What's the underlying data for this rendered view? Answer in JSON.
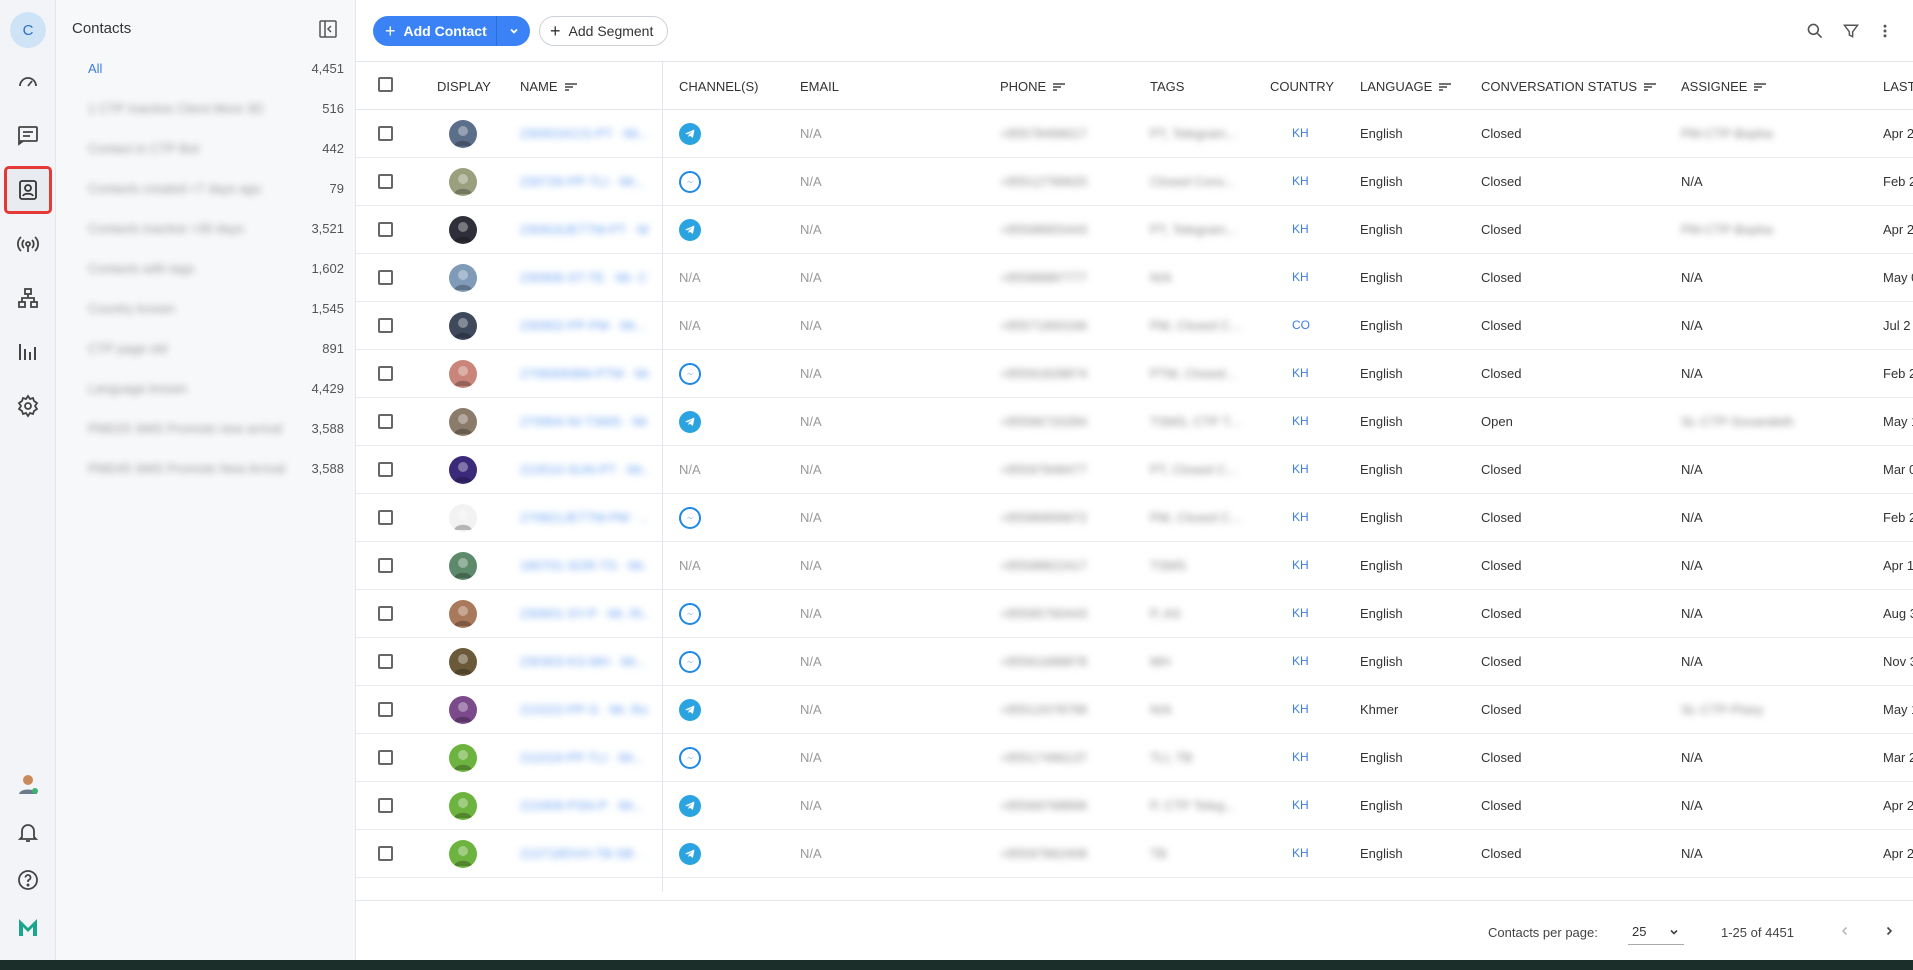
{
  "rail": {
    "avatar_letter": "C",
    "icons": [
      "dashboard-icon",
      "chat-icon",
      "contacts-icon",
      "broadcast-icon",
      "workflow-icon",
      "reports-icon",
      "settings-icon"
    ],
    "bottom_icons": [
      "user-avatar",
      "bell-icon",
      "help-icon",
      "brand-logo"
    ]
  },
  "sidebar": {
    "title": "Contacts",
    "segments": [
      {
        "name": "All",
        "count": "4,451"
      },
      {
        "name": "1 CTP Inactive Client More 3D",
        "count": "516"
      },
      {
        "name": "Contact in CTP Bot",
        "count": "442"
      },
      {
        "name": "Contacts created <7 days ago",
        "count": "79"
      },
      {
        "name": "Contacts inactive >30 days",
        "count": "3,521"
      },
      {
        "name": "Contacts with tags",
        "count": "1,602"
      },
      {
        "name": "Country known",
        "count": "1,545"
      },
      {
        "name": "CTP page old",
        "count": "891"
      },
      {
        "name": "Language known",
        "count": "4,429"
      },
      {
        "name": "PMD25 SMS Promote new arrival",
        "count": "3,588"
      },
      {
        "name": "PMD45 SMS Promote New Arrival",
        "count": "3,588"
      }
    ]
  },
  "toolbar": {
    "add_contact": "Add Contact",
    "add_segment": "Add Segment"
  },
  "table": {
    "headers": {
      "display": "DISPLAY",
      "name": "NAME",
      "channels": "CHANNEL(S)",
      "email": "EMAIL",
      "phone": "PHONE",
      "tags": "TAGS",
      "country": "COUNTRY",
      "language": "LANGUAGE",
      "conversation_status": "CONVERSATION STATUS",
      "assignee": "ASSIGNEE",
      "last": "LAST"
    },
    "rows": [
      {
        "avatar_color": "#5b6f8a",
        "name": "230501KCG-PT · Mr...",
        "channel": "telegram",
        "channel_text": "",
        "email": "N/A",
        "phone": "+85578499017",
        "tags": "PT, Telegram...",
        "country": "KH",
        "language": "English",
        "status": "Closed",
        "assignee": "PM-CTP-Bopha",
        "assignee_blur": true,
        "last": "Apr 2"
      },
      {
        "avatar_color": "#9aa07e",
        "name": "230726-PP-TLI · Mr...",
        "channel": "messenger",
        "channel_text": "",
        "email": "N/A",
        "phone": "+85512799920",
        "tags": "Closed Conv...",
        "country": "KH",
        "language": "English",
        "status": "Closed",
        "assignee": "N/A",
        "assignee_blur": false,
        "last": "Feb 2"
      },
      {
        "avatar_color": "#2f2f3a",
        "name": "230916JETTM-PT · Mr...",
        "channel": "telegram",
        "channel_text": "",
        "email": "N/A",
        "phone": "+85598955443",
        "tags": "PT, Telegram...",
        "country": "KH",
        "language": "English",
        "status": "Closed",
        "assignee": "PM-CTP-Bopha",
        "assignee_blur": true,
        "last": "Apr 2"
      },
      {
        "avatar_color": "#7f9bb8",
        "name": "230906-ST-TE · Mr. C...",
        "channel": "none",
        "channel_text": "N/A",
        "email": "N/A",
        "phone": "+85588887777",
        "tags": "N/A",
        "country": "KH",
        "language": "English",
        "status": "Closed",
        "assignee": "N/A",
        "assignee_blur": false,
        "last": "May 0"
      },
      {
        "avatar_color": "#3e4a5c",
        "name": "230902-PP-PM · Mr...",
        "channel": "none",
        "channel_text": "N/A",
        "email": "N/A",
        "phone": "+85571900166",
        "tags": "PM, Closed C...",
        "country": "CO",
        "language": "English",
        "status": "Closed",
        "assignee": "N/A",
        "assignee_blur": false,
        "last": "Jul 2"
      },
      {
        "avatar_color": "#c9857a",
        "name": "270830KBM-PTM · Mr...",
        "channel": "messenger",
        "channel_text": "",
        "email": "N/A",
        "phone": "+85591828874",
        "tags": "PTM, Closed...",
        "country": "KH",
        "language": "English",
        "status": "Closed",
        "assignee": "N/A",
        "assignee_blur": false,
        "last": "Feb 2"
      },
      {
        "avatar_color": "#8b7b6a",
        "name": "270904-NI-TSMS · Mr...",
        "channel": "telegram",
        "channel_text": "",
        "email": "N/A",
        "phone": "+85596720284",
        "tags": "TSMS, CTP T...",
        "country": "KH",
        "language": "English",
        "status": "Open",
        "assignee": "SL-CTP-Sovandeth",
        "assignee_blur": true,
        "last": "May 1"
      },
      {
        "avatar_color": "#3b2a7a",
        "name": "210510-SUN-PT · Mr...",
        "channel": "none",
        "channel_text": "N/A",
        "email": "N/A",
        "phone": "+85597848477",
        "tags": "PT, Closed C...",
        "country": "KH",
        "language": "English",
        "status": "Closed",
        "assignee": "N/A",
        "assignee_blur": false,
        "last": "Mar 0"
      },
      {
        "avatar_color": "#f2f2f2",
        "name": "270821JETTM-PM · ...",
        "channel": "messenger",
        "channel_text": "",
        "email": "N/A",
        "phone": "+85586899972",
        "tags": "PM, Closed C...",
        "country": "KH",
        "language": "English",
        "status": "Closed",
        "assignee": "N/A",
        "assignee_blur": false,
        "last": "Feb 2"
      },
      {
        "avatar_color": "#5d8a6a",
        "name": "180701-SOR-TS · Mr...",
        "channel": "none",
        "channel_text": "N/A",
        "email": "N/A",
        "phone": "+85598822417",
        "tags": "TSMS",
        "country": "KH",
        "language": "English",
        "status": "Closed",
        "assignee": "N/A",
        "assignee_blur": false,
        "last": "Apr 1"
      },
      {
        "avatar_color": "#a8795a",
        "name": "230601-SY-P · Mr. Ri...",
        "channel": "messenger",
        "channel_text": "",
        "email": "N/A",
        "phone": "+85595760443",
        "tags": "P, AS",
        "country": "KH",
        "language": "English",
        "status": "Closed",
        "assignee": "N/A",
        "assignee_blur": false,
        "last": "Aug 3"
      },
      {
        "avatar_color": "#6a5a3a",
        "name": "230303-KS-MH · Mr...",
        "channel": "messenger",
        "channel_text": "",
        "email": "N/A",
        "phone": "+85561688878",
        "tags": "MH",
        "country": "KH",
        "language": "English",
        "status": "Closed",
        "assignee": "N/A",
        "assignee_blur": false,
        "last": "Nov 3"
      },
      {
        "avatar_color": "#7a4a8a",
        "name": "210222-PP-S · Mr. Ro...",
        "channel": "telegram",
        "channel_text": "",
        "email": "N/A",
        "phone": "+85512078799",
        "tags": "N/A",
        "country": "KH",
        "language": "Khmer",
        "status": "Closed",
        "assignee": "SL-CTP-Pisey",
        "assignee_blur": true,
        "last": "May 1"
      },
      {
        "avatar_color": "#6db33f",
        "name": "211019-PP-TLI · Mr...",
        "channel": "messenger",
        "channel_text": "",
        "email": "N/A",
        "phone": "+85517496137",
        "tags": "TLI, TB",
        "country": "KH",
        "language": "English",
        "status": "Closed",
        "assignee": "N/A",
        "assignee_blur": false,
        "last": "Mar 2"
      },
      {
        "avatar_color": "#6db33f",
        "name": "210409-PSN-P · Mr...",
        "channel": "telegram",
        "channel_text": "",
        "email": "N/A",
        "phone": "+85569768896",
        "tags": "P, CTP Teleg...",
        "country": "KH",
        "language": "English",
        "status": "Closed",
        "assignee": "N/A",
        "assignee_blur": false,
        "last": "Apr 2"
      },
      {
        "avatar_color": "#6db33f",
        "name": "210718DVH-TB-SB · ...",
        "channel": "telegram",
        "channel_text": "",
        "email": "N/A",
        "phone": "+85597862408",
        "tags": "TB",
        "country": "KH",
        "language": "English",
        "status": "Closed",
        "assignee": "N/A",
        "assignee_blur": false,
        "last": "Apr 2"
      }
    ]
  },
  "footer": {
    "per_page_label": "Contacts per page:",
    "per_page_value": "25",
    "range": "1-25 of 4451"
  },
  "colors": {
    "accent": "#3b82f6",
    "link": "#3b7de0",
    "telegram": "#2aa3e0",
    "messenger": "#1e88e5",
    "selected_outline": "#e53935"
  }
}
